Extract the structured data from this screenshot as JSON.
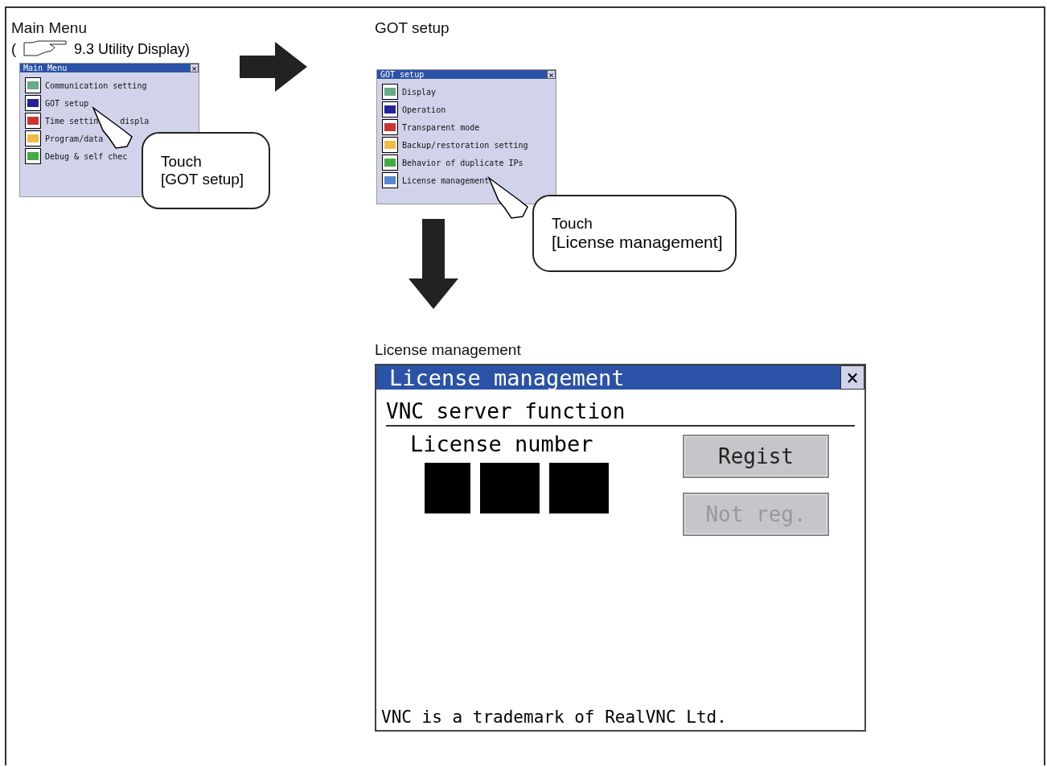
{
  "steps": [
    {
      "title": "Main Menu",
      "ref": "9.3 Utility Display)",
      "ref_open": "(",
      "window": {
        "title": "Main Menu",
        "close": "×",
        "items": [
          {
            "label": "Communication setting"
          },
          {
            "label": "GOT setup"
          },
          {
            "label": "Time settin",
            "label_2": "displa"
          },
          {
            "label": "Program/data"
          },
          {
            "label": "Debug & self chec"
          }
        ]
      },
      "callout": [
        "Touch",
        "[GOT setup]"
      ]
    },
    {
      "title": "GOT setup",
      "window": {
        "title": "GOT setup",
        "close": "×",
        "items": [
          {
            "label": "Display"
          },
          {
            "label": "Operation"
          },
          {
            "label": "Transparent mode"
          },
          {
            "label": "Backup/restoration setting"
          },
          {
            "label": "Behavior of duplicate IPs"
          },
          {
            "label": "License management"
          }
        ]
      },
      "callout": [
        "Touch",
        "[License management]"
      ]
    }
  ],
  "license": {
    "caption": "License management",
    "title": "License management",
    "close": "×",
    "section": "VNC server function",
    "number_label": "License number",
    "buttons": [
      {
        "label": "Regist",
        "disabled": false
      },
      {
        "label": "Not reg.",
        "disabled": true
      }
    ],
    "footer": "VNC is a trademark of RealVNC Ltd."
  }
}
